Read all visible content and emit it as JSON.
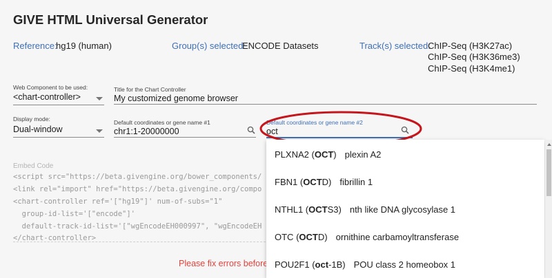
{
  "app": {
    "title": "GIVE HTML Universal Generator"
  },
  "info": {
    "reference_label": "Reference:",
    "reference_value": "hg19 (human)",
    "groups_label": "Group(s) selected:",
    "groups_value": "ENCODE Datasets",
    "tracks_label": "Track(s) selected:",
    "tracks": [
      "ChIP-Seq (H3K27ac)",
      "ChIP-Seq (H3K36me3)",
      "ChIP-Seq (H3K4me1)"
    ]
  },
  "form": {
    "web_component_label": "Web Component to be used:",
    "web_component_value": "<chart-controller>",
    "title_label": "Title for the Chart Controller",
    "title_value": "My customized genome browser",
    "display_mode_label": "Display mode:",
    "display_mode_value": "Dual-window",
    "coord1_label": "Default coordinates or gene name #1",
    "coord1_value": "chr1:1-20000000",
    "coord2_label": "Default coordinates or gene name #2",
    "coord2_value": "oct"
  },
  "embed": {
    "label": "Embed Code",
    "lines": [
      "<script src=\"https://beta.givengine.org/bower_components/",
      "<link rel=\"import\" href=\"https://beta.givengine.org/compo",
      "<chart-controller ref='[\"hg19\"]' num-of-subs=\"1\"",
      "  group-id-list='[\"encode\"]'",
      "  default-track-id-list='[\"wgEncodeEH000997\", \"wgEncodeEH",
      "</chart-controller>"
    ]
  },
  "error": {
    "text": "Please fix errors before u"
  },
  "suggestions": [
    {
      "gene": "PLXNA2",
      "alias_pre": "",
      "alias_match": "OCT",
      "alias_post": "",
      "desc": "plexin A2"
    },
    {
      "gene": "FBN1",
      "alias_pre": "",
      "alias_match": "OCT",
      "alias_post": "D",
      "desc": "fibrillin 1"
    },
    {
      "gene": "NTHL1",
      "alias_pre": "",
      "alias_match": "OCT",
      "alias_post": "S3",
      "desc": "nth like DNA glycosylase 1"
    },
    {
      "gene": "OTC",
      "alias_pre": "",
      "alias_match": "OCT",
      "alias_post": "D",
      "desc": "ornithine carbamoyltransferase"
    },
    {
      "gene": "POU2F1",
      "alias_pre": "",
      "alias_match": "oct",
      "alias_post": "-1B",
      "desc": "POU class 2 homeobox 1"
    }
  ],
  "colors": {
    "accent": "#3f6fb5",
    "error": "#e0443d",
    "annotation": "#c4161c"
  },
  "icons": {
    "search": "search-icon",
    "clear": "clear-icon",
    "dropdown": "chevron-down-icon"
  }
}
